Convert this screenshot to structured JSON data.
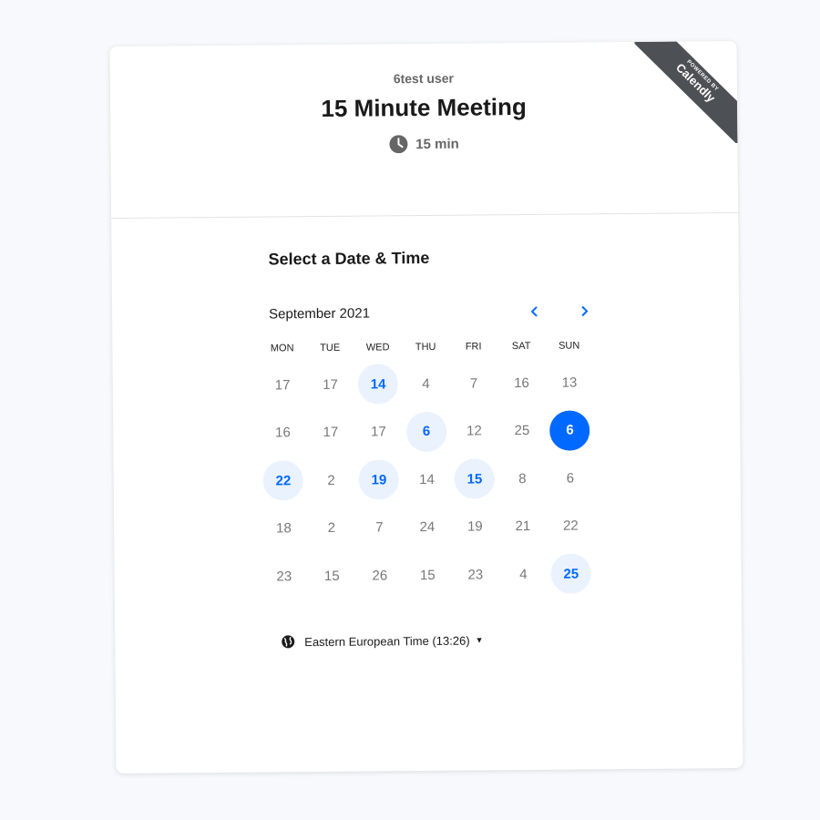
{
  "header": {
    "owner": "6test user",
    "title": "15 Minute Meeting",
    "duration": "15 min"
  },
  "ribbon": {
    "small": "POWERED BY",
    "brand": "Calendly"
  },
  "calendar": {
    "section_title": "Select a Date & Time",
    "month_label": "September 2021",
    "weekdays": [
      "MON",
      "TUE",
      "WED",
      "THU",
      "FRI",
      "SAT",
      "SUN"
    ],
    "weeks": [
      [
        {
          "d": "17"
        },
        {
          "d": "17"
        },
        {
          "d": "14",
          "state": "available"
        },
        {
          "d": "4"
        },
        {
          "d": "7"
        },
        {
          "d": "16"
        },
        {
          "d": "13"
        }
      ],
      [
        {
          "d": "16"
        },
        {
          "d": "17"
        },
        {
          "d": "17"
        },
        {
          "d": "6",
          "state": "available"
        },
        {
          "d": "12"
        },
        {
          "d": "25"
        },
        {
          "d": "6",
          "state": "selected"
        }
      ],
      [
        {
          "d": "22",
          "state": "available"
        },
        {
          "d": "2"
        },
        {
          "d": "19",
          "state": "available"
        },
        {
          "d": "14"
        },
        {
          "d": "15",
          "state": "available"
        },
        {
          "d": "8"
        },
        {
          "d": "6"
        }
      ],
      [
        {
          "d": "18"
        },
        {
          "d": "2"
        },
        {
          "d": "7"
        },
        {
          "d": "24"
        },
        {
          "d": "19"
        },
        {
          "d": "21"
        },
        {
          "d": "22"
        }
      ],
      [
        {
          "d": "23"
        },
        {
          "d": "15"
        },
        {
          "d": "26"
        },
        {
          "d": "15"
        },
        {
          "d": "23"
        },
        {
          "d": "4"
        },
        {
          "d": "25",
          "state": "available"
        }
      ]
    ]
  },
  "timezone": {
    "label": "Eastern European Time (13:26)"
  },
  "icons": {
    "clock": "clock-icon",
    "globe": "globe-icon",
    "prev": "chevron-left-icon",
    "next": "chevron-right-icon",
    "caret": "caret-down-icon"
  },
  "colors": {
    "accent": "#0069ff",
    "available_bg": "#eaf2fe",
    "ribbon": "#4d5055"
  }
}
